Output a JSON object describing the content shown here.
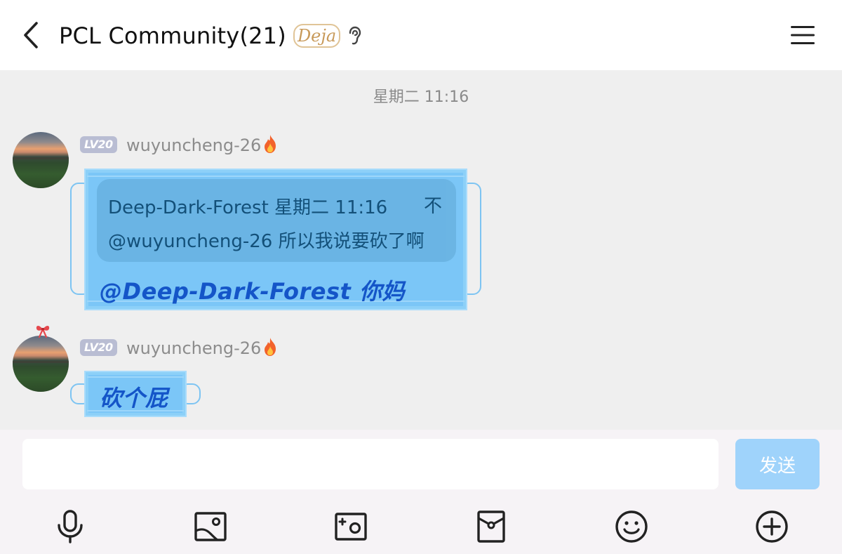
{
  "header": {
    "title": "PCL Community(21)",
    "badge": "Deja",
    "icons": {
      "back": "back-chevron-icon",
      "listen": "ear-icon",
      "menu": "hamburger-menu-icon"
    }
  },
  "chat": {
    "timestamp": "星期二 11:16",
    "messages": [
      {
        "level": "LV20",
        "username": "wuyuncheng-26",
        "flame": "fire-icon",
        "reply": {
          "head": "Deep-Dark-Forest 星期二 11:16",
          "arrow": "不",
          "body": "@wuyuncheng-26 所以我说要砍了啊"
        },
        "text": "@Deep-Dark-Forest 你妈"
      },
      {
        "level": "LV20",
        "username": "wuyuncheng-26",
        "flame": "fire-icon",
        "text": "砍个屁"
      }
    ]
  },
  "input": {
    "placeholder": "",
    "value": "",
    "send_label": "发送"
  },
  "toolbar": {
    "items": [
      "microphone-icon",
      "image-icon",
      "camera-icon",
      "red-packet-icon",
      "emoji-icon",
      "plus-icon"
    ]
  },
  "colors": {
    "bubble": "#7bc6f7",
    "mention": "#1455c8",
    "send_button": "#9fd3fb",
    "level_badge": "#b9bdd3"
  }
}
